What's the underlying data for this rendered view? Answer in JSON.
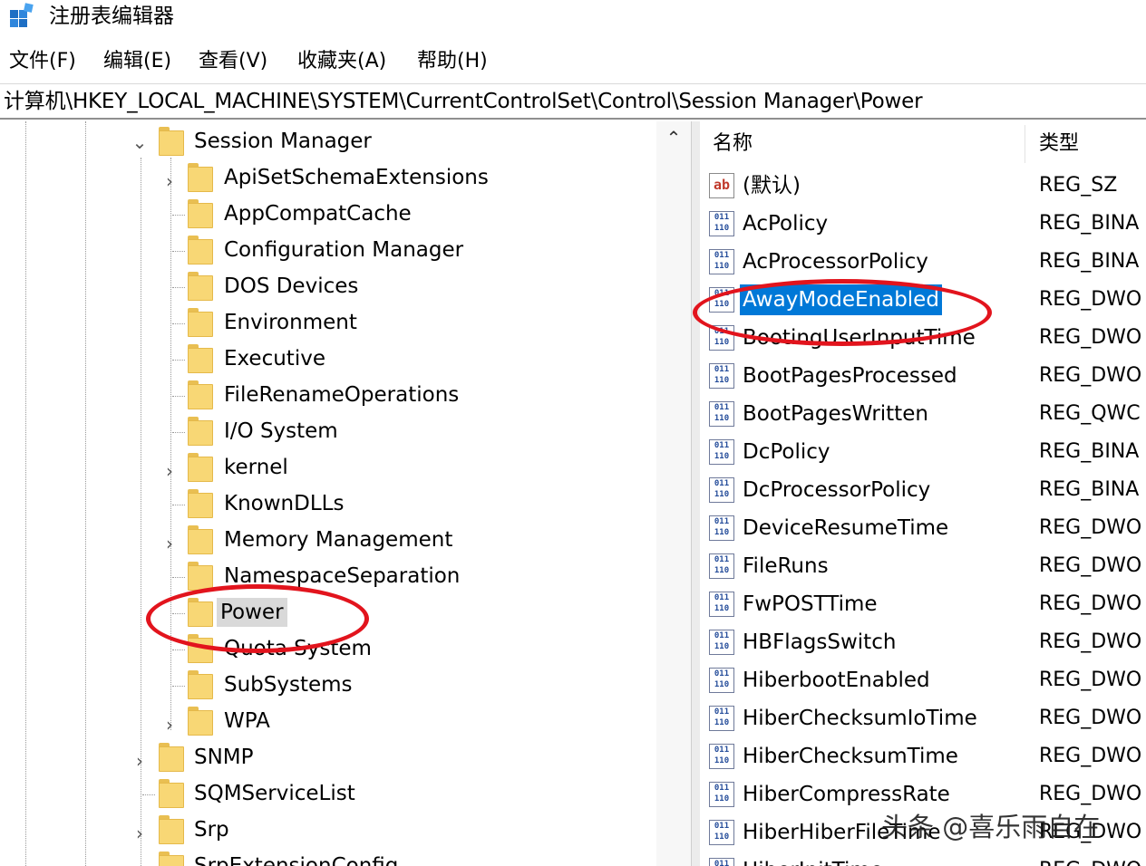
{
  "window": {
    "title": "注册表编辑器",
    "icon": "registry-editor-icon"
  },
  "menu": [
    "文件(F)",
    "编辑(E)",
    "查看(V)",
    "收藏夹(A)",
    "帮助(H)"
  ],
  "address": "计算机\\HKEY_LOCAL_MACHINE\\SYSTEM\\CurrentControlSet\\Control\\Session Manager\\Power",
  "tree": {
    "parent": {
      "label": "Session Manager",
      "expanded": true
    },
    "children": [
      {
        "label": "ApiSetSchemaExtensions",
        "expandable": true
      },
      {
        "label": "AppCompatCache",
        "expandable": false
      },
      {
        "label": "Configuration Manager",
        "expandable": false
      },
      {
        "label": "DOS Devices",
        "expandable": false
      },
      {
        "label": "Environment",
        "expandable": false
      },
      {
        "label": "Executive",
        "expandable": false
      },
      {
        "label": "FileRenameOperations",
        "expandable": false
      },
      {
        "label": "I/O System",
        "expandable": false
      },
      {
        "label": "kernel",
        "expandable": true
      },
      {
        "label": "KnownDLLs",
        "expandable": false
      },
      {
        "label": "Memory Management",
        "expandable": true
      },
      {
        "label": "NamespaceSeparation",
        "expandable": false
      },
      {
        "label": "Power",
        "expandable": false,
        "selected": true
      },
      {
        "label": "Quota System",
        "expandable": false
      },
      {
        "label": "SubSystems",
        "expandable": false
      },
      {
        "label": "WPA",
        "expandable": true
      }
    ],
    "siblings": [
      {
        "label": "SNMP",
        "expandable": true
      },
      {
        "label": "SQMServiceList",
        "expandable": false
      },
      {
        "label": "Srp",
        "expandable": true
      },
      {
        "label": "SrpExtensionConfig",
        "expandable": false
      }
    ]
  },
  "list": {
    "columns": {
      "name": "名称",
      "type": "类型"
    },
    "rows": [
      {
        "name": "(默认)",
        "type": "REG_SZ",
        "icon": "ab"
      },
      {
        "name": "AcPolicy",
        "type": "REG_BINA",
        "icon": "bin"
      },
      {
        "name": "AcProcessorPolicy",
        "type": "REG_BINA",
        "icon": "bin"
      },
      {
        "name": "AwayModeEnabled",
        "type": "REG_DWO",
        "icon": "bin",
        "selected": true
      },
      {
        "name": "BootingUserInputTime",
        "type": "REG_DWO",
        "icon": "bin"
      },
      {
        "name": "BootPagesProcessed",
        "type": "REG_DWO",
        "icon": "bin"
      },
      {
        "name": "BootPagesWritten",
        "type": "REG_QWC",
        "icon": "bin"
      },
      {
        "name": "DcPolicy",
        "type": "REG_BINA",
        "icon": "bin"
      },
      {
        "name": "DcProcessorPolicy",
        "type": "REG_BINA",
        "icon": "bin"
      },
      {
        "name": "DeviceResumeTime",
        "type": "REG_DWO",
        "icon": "bin"
      },
      {
        "name": "FileRuns",
        "type": "REG_DWO",
        "icon": "bin"
      },
      {
        "name": "FwPOSTTime",
        "type": "REG_DWO",
        "icon": "bin"
      },
      {
        "name": "HBFlagsSwitch",
        "type": "REG_DWO",
        "icon": "bin"
      },
      {
        "name": "HiberbootEnabled",
        "type": "REG_DWO",
        "icon": "bin"
      },
      {
        "name": "HiberChecksumIoTime",
        "type": "REG_DWO",
        "icon": "bin"
      },
      {
        "name": "HiberChecksumTime",
        "type": "REG_DWO",
        "icon": "bin"
      },
      {
        "name": "HiberCompressRate",
        "type": "REG_DWO",
        "icon": "bin"
      },
      {
        "name": "HiberHiberFileTime",
        "type": "REG_DWO",
        "icon": "bin"
      },
      {
        "name": "HiberInitTime",
        "type": "REG_DWO",
        "icon": "bin"
      }
    ]
  },
  "icon_text": {
    "ab": "ab",
    "bin": "011\n110"
  },
  "watermark": "头条 @喜乐雨自在",
  "colors": {
    "selection": "#0078d7",
    "highlight_ellipse": "#e2141d",
    "folder": "#f8d775",
    "tree_selected": "#d9d9d9"
  }
}
